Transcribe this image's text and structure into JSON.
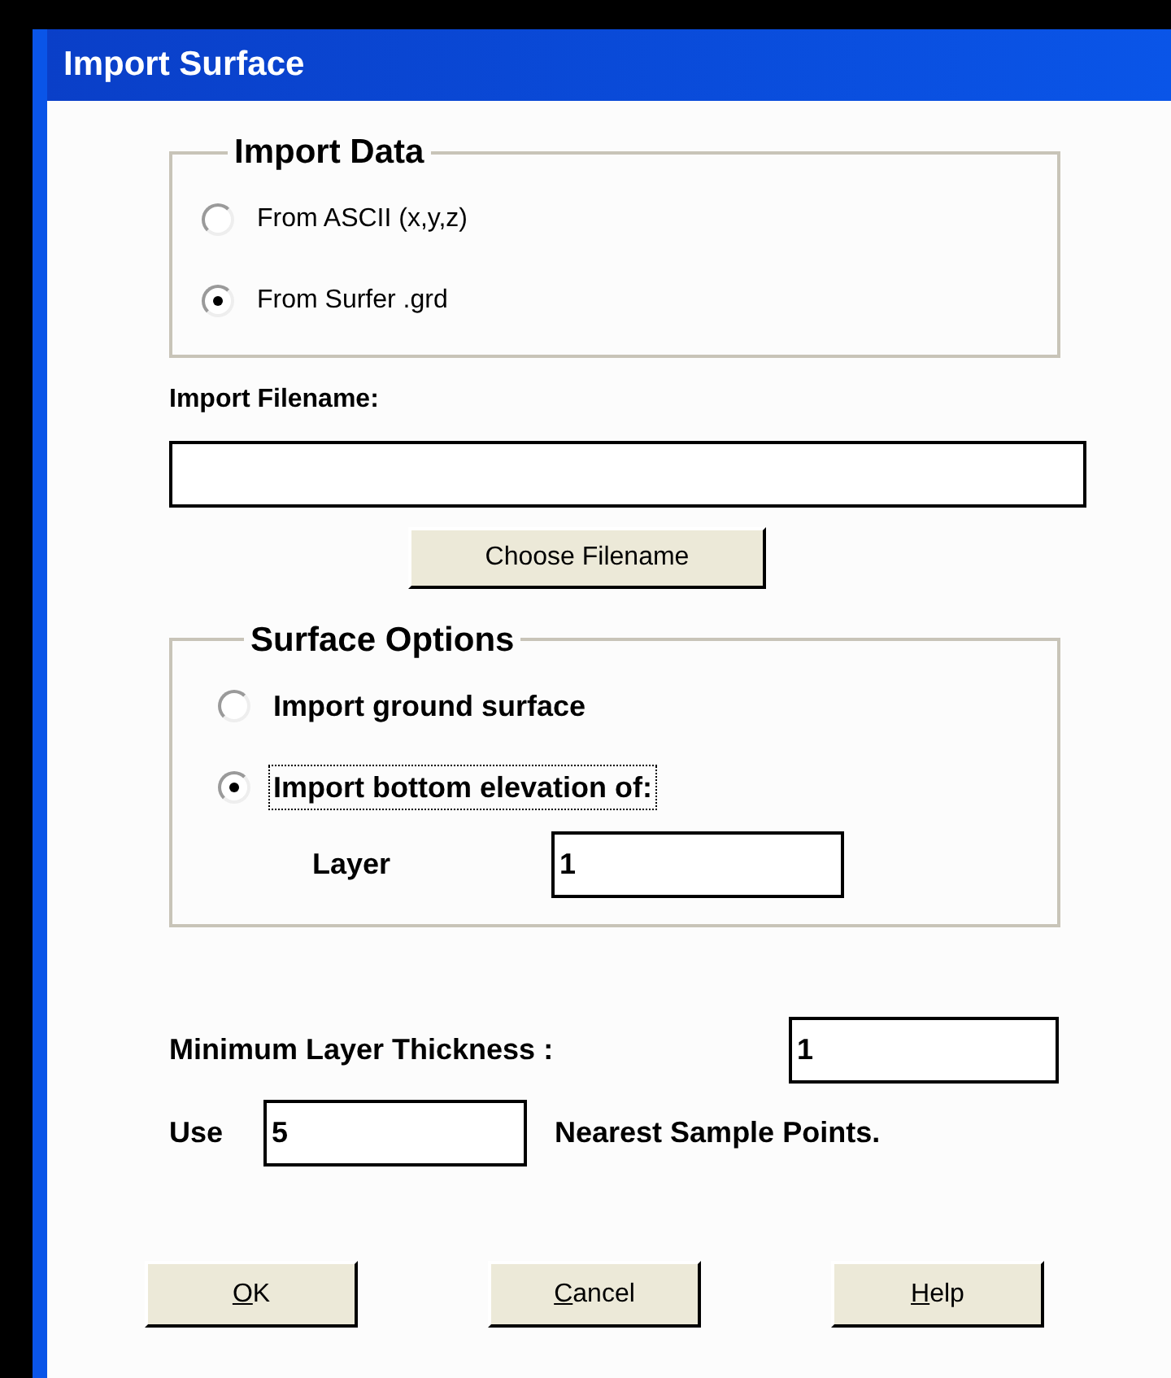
{
  "window": {
    "title": "Import Surface"
  },
  "import_data": {
    "legend": "Import Data",
    "options": [
      {
        "label": "From ASCII (x,y,z)",
        "selected": false,
        "focused": false
      },
      {
        "label": "From Surfer .grd",
        "selected": true,
        "focused": false
      }
    ]
  },
  "import_filename": {
    "label": "Import Filename:"
  },
  "choose_button": "Choose Filename",
  "surface_options": {
    "legend": "Surface Options",
    "options": [
      {
        "label": "Import ground surface",
        "selected": false,
        "focused": false
      },
      {
        "label": "Import bottom elevation of:",
        "selected": true,
        "focused": true
      }
    ],
    "layer": {
      "label": "Layer",
      "value": "1"
    }
  },
  "min_thickness": {
    "label": "Minimum Layer Thickness :",
    "value": "1"
  },
  "sample_points": {
    "prefix": "Use",
    "value": "5",
    "suffix": "Nearest Sample Points."
  },
  "buttons": [
    {
      "label": "OK",
      "mnemonic_underlined": true
    },
    {
      "label": "Cancel",
      "mnemonic_underlined": true
    },
    {
      "label": "Help",
      "mnemonic_underlined": true
    }
  ]
}
